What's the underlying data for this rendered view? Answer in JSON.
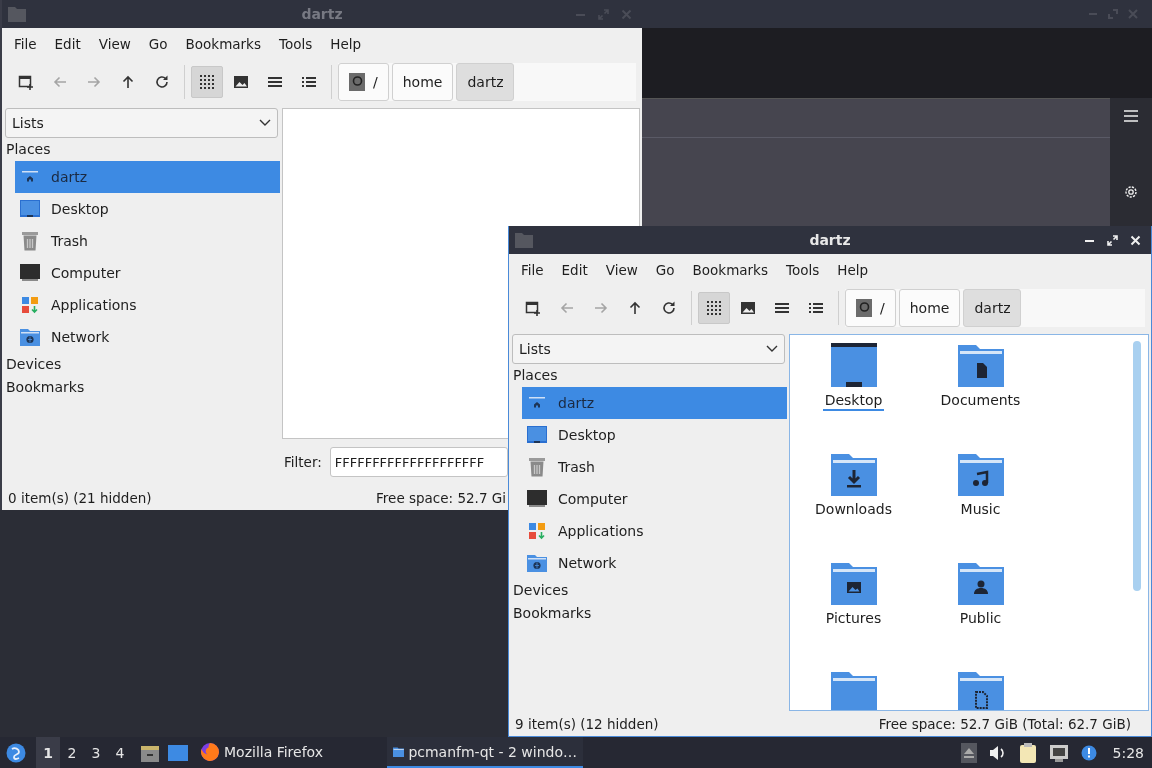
{
  "windows": [
    {
      "title": "dartz",
      "active": false,
      "menu": [
        "File",
        "Edit",
        "View",
        "Go",
        "Bookmarks",
        "Tools",
        "Help"
      ],
      "toolbar": [
        {
          "kind": "new-tab",
          "disabled": false,
          "selected": false
        },
        {
          "kind": "back",
          "disabled": true,
          "selected": false
        },
        {
          "kind": "forward",
          "disabled": true,
          "selected": false
        },
        {
          "kind": "up",
          "disabled": false,
          "selected": false
        },
        {
          "kind": "reload",
          "disabled": false,
          "selected": false
        },
        {
          "kind": "icon-view",
          "disabled": false,
          "selected": true
        },
        {
          "kind": "thumbnail-view",
          "disabled": false,
          "selected": false
        },
        {
          "kind": "compact-view",
          "disabled": false,
          "selected": false
        },
        {
          "kind": "detailed-view",
          "disabled": false,
          "selected": false
        }
      ],
      "path": [
        {
          "label": "/",
          "kind": "root",
          "selected": false
        },
        {
          "label": "home",
          "kind": "folder",
          "selected": false
        },
        {
          "label": "dartz",
          "kind": "folder",
          "selected": true
        }
      ],
      "side_pane": {
        "mode": "Lists",
        "sections": [
          {
            "label": "Places",
            "items": [
              {
                "label": "dartz",
                "kind": "home",
                "selected": true
              },
              {
                "label": "Desktop",
                "kind": "desktop",
                "selected": false
              },
              {
                "label": "Trash",
                "kind": "trash",
                "selected": false
              },
              {
                "label": "Computer",
                "kind": "computer",
                "selected": false
              },
              {
                "label": "Applications",
                "kind": "applications",
                "selected": false
              },
              {
                "label": "Network",
                "kind": "network",
                "selected": false
              }
            ]
          },
          {
            "label": "Devices"
          },
          {
            "label": "Bookmarks"
          }
        ]
      },
      "filter": {
        "label": "Filter:",
        "value": "FFFFFFFFFFFFFFFFFFFF"
      },
      "status": {
        "items": "0 item(s) (21 hidden)",
        "space": "Free space: 52.7 Gi"
      }
    },
    {
      "title": "dartz",
      "active": true,
      "menu": [
        "File",
        "Edit",
        "View",
        "Go",
        "Bookmarks",
        "Tools",
        "Help"
      ],
      "toolbar": [
        {
          "kind": "new-tab",
          "disabled": false,
          "selected": false
        },
        {
          "kind": "back",
          "disabled": true,
          "selected": false
        },
        {
          "kind": "forward",
          "disabled": true,
          "selected": false
        },
        {
          "kind": "up",
          "disabled": false,
          "selected": false
        },
        {
          "kind": "reload",
          "disabled": false,
          "selected": false
        },
        {
          "kind": "icon-view",
          "disabled": false,
          "selected": true
        },
        {
          "kind": "thumbnail-view",
          "disabled": false,
          "selected": false
        },
        {
          "kind": "compact-view",
          "disabled": false,
          "selected": false
        },
        {
          "kind": "detailed-view",
          "disabled": false,
          "selected": false
        }
      ],
      "path": [
        {
          "label": "/",
          "kind": "root",
          "selected": false
        },
        {
          "label": "home",
          "kind": "folder",
          "selected": false
        },
        {
          "label": "dartz",
          "kind": "folder",
          "selected": true
        }
      ],
      "side_pane": {
        "mode": "Lists",
        "sections": [
          {
            "label": "Places",
            "items": [
              {
                "label": "dartz",
                "kind": "home",
                "selected": true
              },
              {
                "label": "Desktop",
                "kind": "desktop",
                "selected": false
              },
              {
                "label": "Trash",
                "kind": "trash",
                "selected": false
              },
              {
                "label": "Computer",
                "kind": "computer",
                "selected": false
              },
              {
                "label": "Applications",
                "kind": "applications",
                "selected": false
              },
              {
                "label": "Network",
                "kind": "network",
                "selected": false
              }
            ]
          },
          {
            "label": "Devices"
          },
          {
            "label": "Bookmarks"
          }
        ]
      },
      "files": [
        {
          "name": "Desktop",
          "kind": "desktop",
          "current": true
        },
        {
          "name": "Documents",
          "kind": "documents",
          "current": false
        },
        {
          "name": "Downloads",
          "kind": "downloads",
          "current": false
        },
        {
          "name": "Music",
          "kind": "music",
          "current": false
        },
        {
          "name": "Pictures",
          "kind": "pictures",
          "current": false
        },
        {
          "name": "Public",
          "kind": "public",
          "current": false
        },
        {
          "kind": "plain"
        },
        {
          "kind": "templates"
        }
      ],
      "status": {
        "items": "9 item(s) (12 hidden)",
        "space": "Free space: 52.7 GiB (Total: 62.7 GiB)"
      }
    }
  ],
  "taskbar": {
    "workspaces": [
      {
        "label": "1",
        "selected": true
      },
      {
        "label": "2",
        "selected": false
      },
      {
        "label": "3",
        "selected": false
      },
      {
        "label": "4",
        "selected": false
      }
    ],
    "tasks": [
      {
        "label": "Mozilla Firefox",
        "kind": "browser",
        "selected": false
      },
      {
        "label": "pcmanfm-qt - 2 windo…",
        "kind": "file-manager",
        "selected": true
      }
    ],
    "clock": "5:28"
  }
}
